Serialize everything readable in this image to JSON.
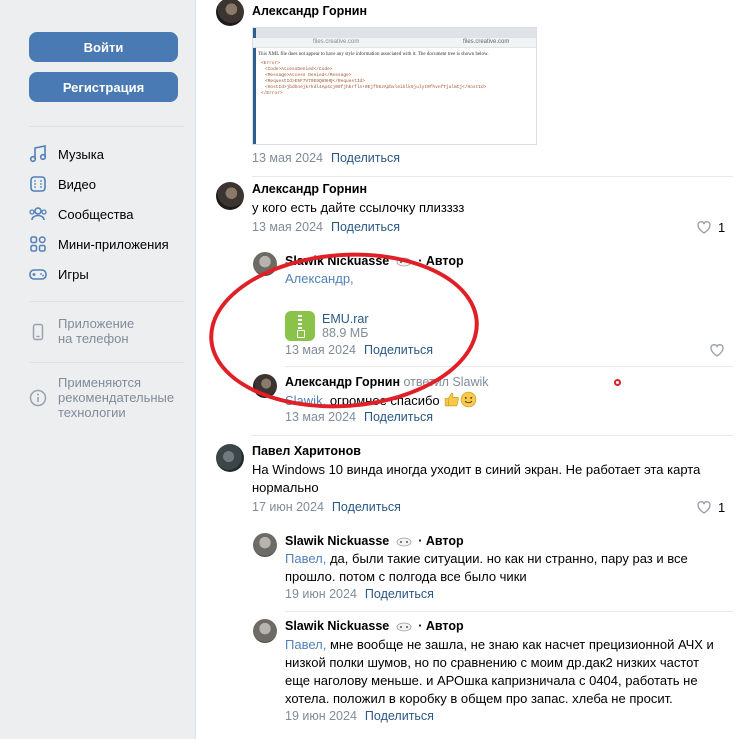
{
  "sidebar": {
    "login": "Войти",
    "register": "Регистрация",
    "menu": [
      {
        "label": "Музыка",
        "icon": "music-icon"
      },
      {
        "label": "Видео",
        "icon": "video-icon"
      },
      {
        "label": "Сообщества",
        "icon": "communities-icon"
      },
      {
        "label": "Мини-приложения",
        "icon": "mini-apps-icon"
      },
      {
        "label": "Игры",
        "icon": "gamepad-icon"
      }
    ],
    "app_line1": "Приложение",
    "app_line2": "на телефон",
    "rec_line1": "Применяются",
    "rec_line2": "рекомендательные",
    "rec_line3": "технологии"
  },
  "screenshot_attachment": {
    "url_text": "files.creative.com",
    "host_text": "files.creative.com",
    "message": "This XML file does not appear to have any style information associated with it. The document tree is shown below.",
    "code_lines": [
      "<Error>",
      "<Code>AccessDenied</Code>",
      "<Message>Access Denied</Message>",
      "<RequestId>E5F7VT0E9Q89HQ</RequestId>",
      "<HostId>jbdhnejkrkdl4Ap4cj09fjhbrfln+0Ejfh8JApbvleiklk9julyt0fhvnfTjulmtj</HostId>",
      "</Error>"
    ]
  },
  "comments": [
    {
      "author": "Александр Горнин",
      "date": "13 мая 2024",
      "share": "Поделиться"
    },
    {
      "author": "Александр Горнин",
      "text": "у кого есть дайте ссылочку плизззз",
      "date": "13 мая 2024",
      "share": "Поделиться",
      "likes": "1"
    },
    {
      "author": "Slawik Nickuasse",
      "author_tag": "· Автор",
      "reply_to": "Александр,",
      "file_name": "EMU.rar",
      "file_size": "88.9 МБ",
      "date": "13 мая 2024",
      "share": "Поделиться"
    },
    {
      "author": "Александр Горнин",
      "replied": "ответил Slawik",
      "reply_to": "Slawik,",
      "text": "огромное спасибо",
      "date": "13 мая 2024",
      "share": "Поделиться"
    },
    {
      "author": "Павел Харитонов",
      "text_line1": "На Windows 10 винда иногда уходит в синий экран. Не работает эта карта",
      "text_line2": "нормально",
      "date": "17 июн 2024",
      "share": "Поделиться",
      "likes": "1"
    },
    {
      "author": "Slawik Nickuasse",
      "author_tag": "· Автор",
      "reply_to": "Павел,",
      "text_line1": "да, были такие ситуации. но как ни странно, пару раз и все",
      "text_line2": "прошло. потом с полгода все было чики",
      "date": "19 июн 2024",
      "share": "Поделиться"
    },
    {
      "author": "Slawik Nickuasse",
      "author_tag": "· Автор",
      "reply_to": "Павел,",
      "text_line1": "мне вообще не зашла, не знаю как насчет прецизионной АЧХ и",
      "text_line2": "низкой полки шумов, но по сравнению с моим др.дак2 низких частот",
      "text_line3": "еще наголову меньше. и АРОшка капризничала с 0404, работать не",
      "text_line4": "хотела. положил в коробку в общем про запас. хлеба не просит.",
      "date": "19 июн 2024",
      "share": "Поделиться"
    }
  ]
}
